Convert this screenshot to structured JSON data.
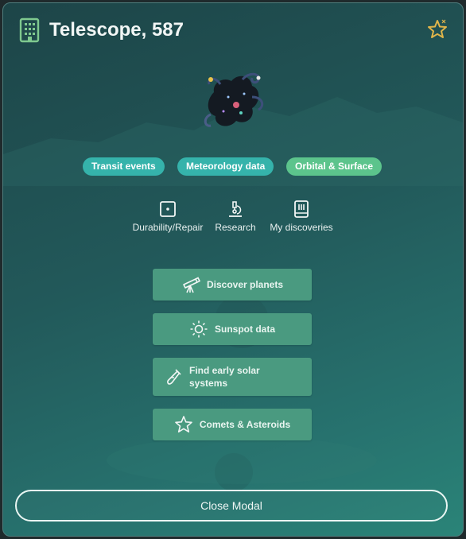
{
  "header": {
    "title": "Telescope, 587",
    "building_icon": "building-icon",
    "favorite_icon": "star-outline-icon"
  },
  "colors": {
    "accent_teal": "#35b3ab",
    "accent_green": "#5cc48c",
    "action_bg": "#4a9a80",
    "favorite_star": "#e0b54a"
  },
  "tags": [
    {
      "label": "Transit events"
    },
    {
      "label": "Meteorology data"
    },
    {
      "label": "Orbital & Surface"
    }
  ],
  "tabs": [
    {
      "label": "Durability/Repair",
      "icon": "dice-icon"
    },
    {
      "label": "Research",
      "icon": "microscope-icon"
    },
    {
      "label": "My discoveries",
      "icon": "book-icon"
    }
  ],
  "actions": [
    {
      "label": "Discover planets",
      "icon": "telescope-icon"
    },
    {
      "label": "Sunspot data",
      "icon": "sun-icon"
    },
    {
      "label": "Find early solar\nsystems",
      "icon": "test-tube-icon"
    },
    {
      "label": "Comets & Asteroids",
      "icon": "star-icon"
    }
  ],
  "footer": {
    "close_label": "Close Modal"
  }
}
